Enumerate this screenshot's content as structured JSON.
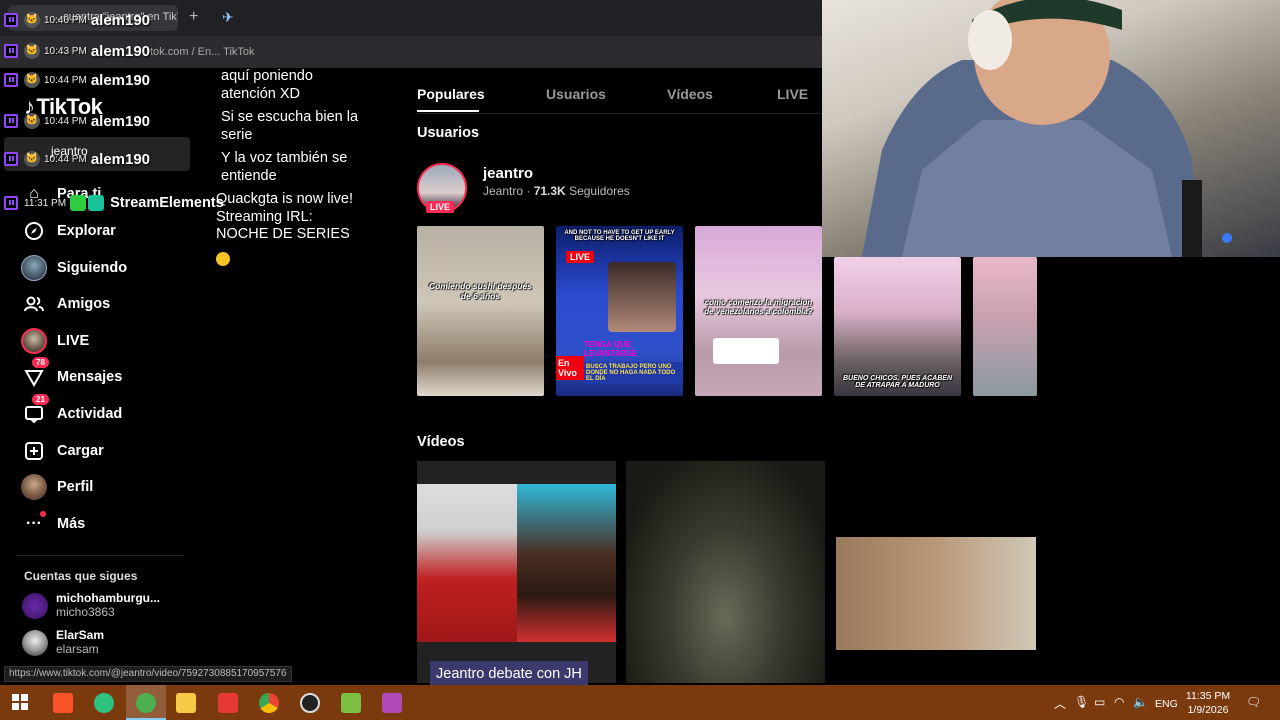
{
  "browser": {
    "tab_title": "...cuentra \"jeantro\" en TikTok",
    "new_tab_symbol": "+",
    "url": "tok.com / En... TikTok",
    "status_url": "https://www.tiktok.com/@jeantro/video/7592730885170957576"
  },
  "chat": {
    "rows": [
      {
        "time": "10:40 PM",
        "user": "alem190"
      },
      {
        "time": "10:43 PM",
        "user": "alem190"
      },
      {
        "time": "10:44 PM",
        "user": "alem190"
      },
      {
        "time": "10:44 PM",
        "user": "alem190"
      },
      {
        "time": "10:44 PM",
        "user": "alem190"
      }
    ],
    "messages": [
      "aquí poniendo atención XD",
      "Si se escucha bien la serie",
      "Y la voz también se entiende",
      "Quackgta is now live! Streaming IRL: NOCHE DE SERIES"
    ],
    "se_time": "11:31 PM",
    "se_name": "StreamElements",
    "tooltip_user": "jeantro"
  },
  "sidebar": {
    "logo": "TikTok",
    "items": [
      {
        "label": "Para ti",
        "icon": "home-icon"
      },
      {
        "label": "Explorar",
        "icon": "compass-icon"
      },
      {
        "label": "Siguiendo",
        "icon": "following-icon"
      },
      {
        "label": "Amigos",
        "icon": "friends-icon"
      },
      {
        "label": "LIVE",
        "icon": "live-icon"
      },
      {
        "label": "Mensajes",
        "icon": "messages-icon",
        "badge": "78"
      },
      {
        "label": "Actividad",
        "icon": "activity-icon",
        "badge": "21"
      },
      {
        "label": "Cargar",
        "icon": "upload-icon"
      },
      {
        "label": "Perfil",
        "icon": "profile-icon"
      },
      {
        "label": "Más",
        "icon": "more-icon"
      }
    ],
    "following_title": "Cuentas que sigues",
    "following": [
      {
        "name": "michohamburgu...",
        "handle": "micho3863"
      },
      {
        "name": "ElarSam",
        "handle": "elarsam"
      }
    ]
  },
  "search": {
    "tabs": [
      "Populares",
      "Usuarios",
      "Vídeos",
      "LIVE"
    ],
    "active_tab": "Populares",
    "users_title": "Usuarios",
    "videos_title": "Vídeos",
    "user": {
      "name": "jeantro",
      "display": "Jeantro",
      "followers": "71.3K",
      "followers_label": "Seguidores",
      "live_label": "LIVE"
    },
    "thumbs": [
      {
        "caption": "Comiendo sushi después de 6 años"
      },
      {
        "caption": "AND NOT TO HAVE TO GET UP EARLY BECAUSE HE DOESN'T LIKE IT",
        "live": "LIVE",
        "en_vivo": "En Vivo",
        "tenga": "TENGA QUE",
        "tenga_hl": "LEVANTARSE",
        "news": "BUSCA TRABAJO PERO UNO DONDE NO HAGA NADA TODO EL DÍA"
      },
      {
        "caption": "como comenzo la migracion de venezolanos a colombia?"
      },
      {
        "caption": "BUENO CHICOS, PUES ACABEN DE ATRAPAR A MADURO"
      },
      {
        "caption": ""
      }
    ],
    "video_title": "Jeantro debate con JH"
  },
  "taskbar": {
    "lang": "ENG",
    "time": "11:35 PM",
    "date": "1/9/2026"
  }
}
